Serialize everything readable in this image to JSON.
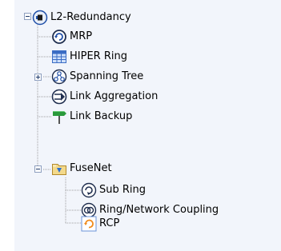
{
  "tree": {
    "root": {
      "label": "L2-Redundancy",
      "icon": "l2-redundancy-icon",
      "expanded": true
    },
    "items": [
      {
        "label": "MRP",
        "icon": "mrp-ring-icon"
      },
      {
        "label": "HIPER Ring",
        "icon": "hiper-ring-grid-icon"
      },
      {
        "label": "Spanning Tree",
        "icon": "spanning-tree-icon",
        "expandable": true,
        "expanded": false
      },
      {
        "label": "Link Aggregation",
        "icon": "link-aggregation-icon"
      },
      {
        "label": "Link Backup",
        "icon": "link-backup-icon"
      },
      {
        "label": "FuseNet",
        "icon": "fusenet-folder-icon",
        "expandable": true,
        "expanded": true,
        "children": [
          {
            "label": "Sub Ring",
            "icon": "sub-ring-icon"
          },
          {
            "label": "Ring/Network Coupling",
            "icon": "ring-coupling-icon"
          },
          {
            "label": "RCP",
            "icon": "rcp-icon"
          }
        ]
      }
    ]
  },
  "colors": {
    "panel_bg": "#f2f5fb",
    "tree_lines": "#a0a0a0",
    "icon_blue": "#1f4fa8"
  }
}
